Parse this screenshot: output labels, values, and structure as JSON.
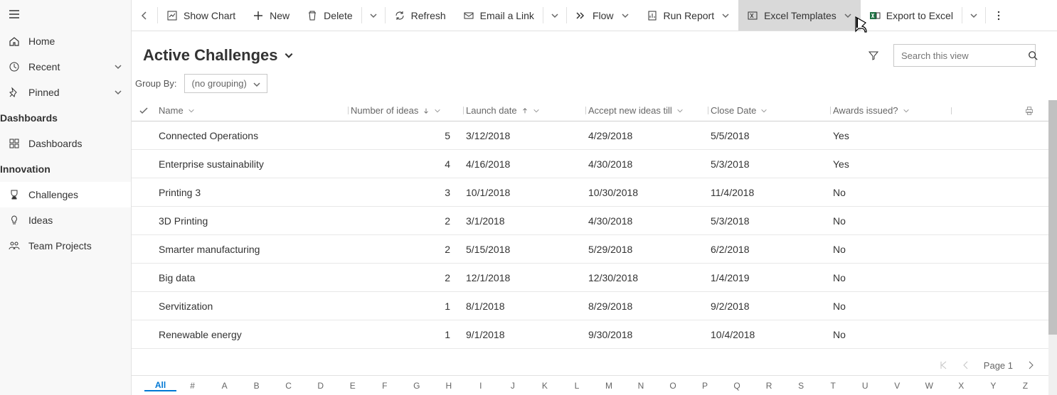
{
  "sidebar": {
    "top": [
      {
        "icon": "home",
        "label": "Home"
      },
      {
        "icon": "clock",
        "label": "Recent",
        "chev": true
      },
      {
        "icon": "pin",
        "label": "Pinned",
        "chev": true
      }
    ],
    "sections": [
      {
        "label": "Dashboards",
        "items": [
          {
            "icon": "dashboard",
            "label": "Dashboards"
          }
        ]
      },
      {
        "label": "Innovation",
        "items": [
          {
            "icon": "trophy",
            "label": "Challenges",
            "active": true
          },
          {
            "icon": "bulb",
            "label": "Ideas"
          },
          {
            "icon": "people",
            "label": "Team Projects"
          }
        ]
      }
    ]
  },
  "cmdbar": {
    "show_chart": "Show Chart",
    "new": "New",
    "delete": "Delete",
    "refresh": "Refresh",
    "email": "Email a Link",
    "flow": "Flow",
    "run_report": "Run Report",
    "excel_templates": "Excel Templates",
    "export_excel": "Export to Excel"
  },
  "view": {
    "title": "Active Challenges",
    "groupby_label": "Group By:",
    "groupby_value": "(no grouping)"
  },
  "search": {
    "placeholder": "Search this view"
  },
  "columns": {
    "name": "Name",
    "num": "Number of ideas",
    "launch": "Launch date",
    "accept": "Accept new ideas till",
    "close": "Close Date",
    "awards": "Awards issued?"
  },
  "rows": [
    {
      "name": "Connected Operations",
      "num": "5",
      "launch": "3/12/2018",
      "accept": "4/29/2018",
      "close": "5/5/2018",
      "awards": "Yes"
    },
    {
      "name": "Enterprise sustainability",
      "num": "4",
      "launch": "4/16/2018",
      "accept": "4/30/2018",
      "close": "5/3/2018",
      "awards": "Yes"
    },
    {
      "name": "Printing 3",
      "num": "3",
      "launch": "10/1/2018",
      "accept": "10/30/2018",
      "close": "11/4/2018",
      "awards": "No"
    },
    {
      "name": "3D Printing",
      "num": "2",
      "launch": "3/1/2018",
      "accept": "4/30/2018",
      "close": "5/3/2018",
      "awards": "No"
    },
    {
      "name": "Smarter manufacturing",
      "num": "2",
      "launch": "5/15/2018",
      "accept": "5/29/2018",
      "close": "6/2/2018",
      "awards": "No"
    },
    {
      "name": "Big data",
      "num": "2",
      "launch": "12/1/2018",
      "accept": "12/30/2018",
      "close": "1/4/2019",
      "awards": "No"
    },
    {
      "name": "Servitization",
      "num": "1",
      "launch": "8/1/2018",
      "accept": "8/29/2018",
      "close": "9/2/2018",
      "awards": "No"
    },
    {
      "name": "Renewable energy",
      "num": "1",
      "launch": "9/1/2018",
      "accept": "9/30/2018",
      "close": "10/4/2018",
      "awards": "No"
    }
  ],
  "pager": {
    "page": "Page 1"
  },
  "alpha": [
    "All",
    "#",
    "A",
    "B",
    "C",
    "D",
    "E",
    "F",
    "G",
    "H",
    "I",
    "J",
    "K",
    "L",
    "M",
    "N",
    "O",
    "P",
    "Q",
    "R",
    "S",
    "T",
    "U",
    "V",
    "W",
    "X",
    "Y",
    "Z"
  ]
}
